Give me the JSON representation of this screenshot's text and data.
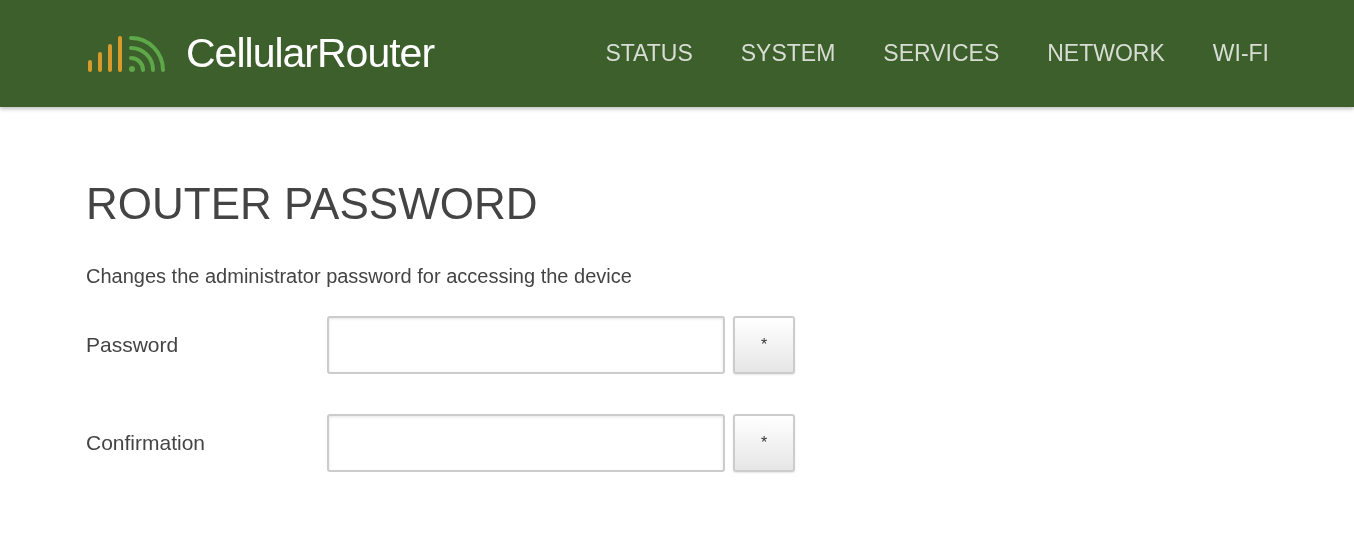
{
  "header": {
    "brand": "CellularRouter",
    "nav": [
      {
        "label": "STATUS"
      },
      {
        "label": "SYSTEM"
      },
      {
        "label": "SERVICES"
      },
      {
        "label": "NETWORK"
      },
      {
        "label": "WI-FI"
      }
    ]
  },
  "page": {
    "title": "ROUTER PASSWORD",
    "description": "Changes the administrator password for accessing the device",
    "fields": [
      {
        "label": "Password",
        "button": "*"
      },
      {
        "label": "Confirmation",
        "button": "*"
      }
    ]
  }
}
